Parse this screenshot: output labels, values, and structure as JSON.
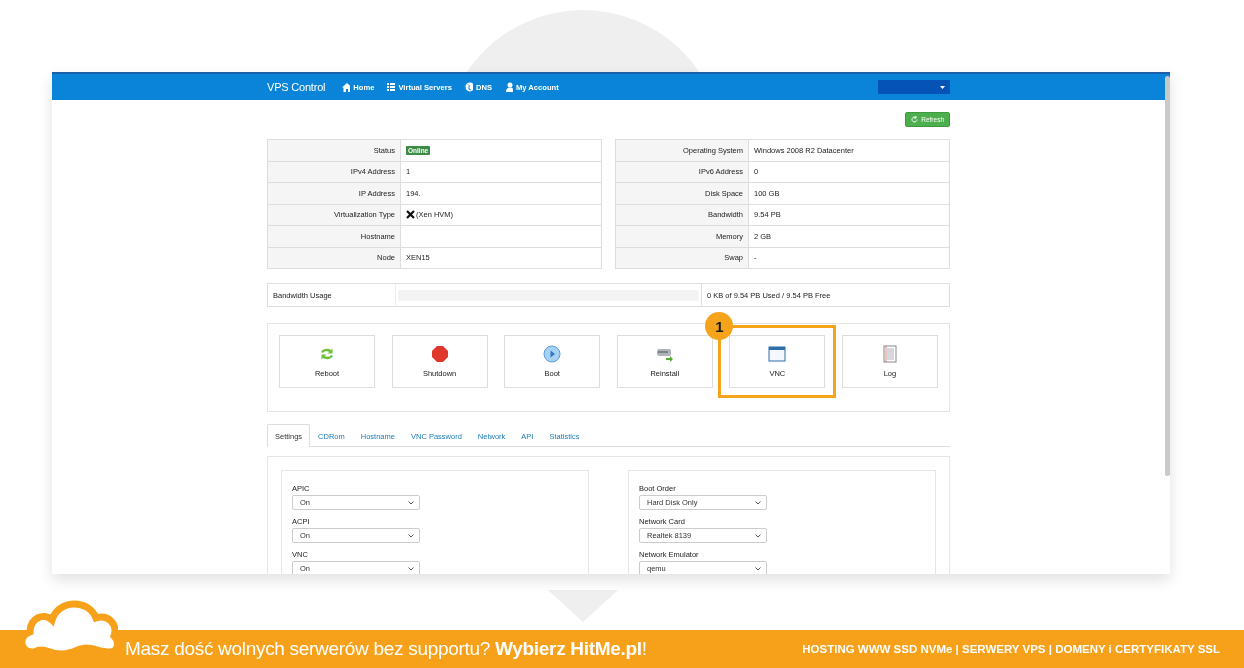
{
  "nav": {
    "brand": "VPS Control",
    "items": [
      {
        "label": "Home"
      },
      {
        "label": "Virtual Servers"
      },
      {
        "label": "DNS"
      },
      {
        "label": "My Account"
      }
    ]
  },
  "refresh_button": "Refresh",
  "info_left": [
    {
      "label": "Status",
      "value": "Online",
      "kind": "badge"
    },
    {
      "label": "IPv4 Address",
      "value": "1",
      "kind": "text"
    },
    {
      "label": "IP Address",
      "value": "194.",
      "kind": "text"
    },
    {
      "label": "Virtualization Type",
      "value": "(Xen HVM)",
      "kind": "icon-text"
    },
    {
      "label": "Hostname",
      "kind": "text"
    },
    {
      "label": "Node",
      "value": "XEN15",
      "kind": "text"
    }
  ],
  "info_right": [
    {
      "label": "Operating System",
      "value": "Windows 2008 R2 Datacenter",
      "kind": "text"
    },
    {
      "label": "IPv6 Address",
      "value": "0",
      "kind": "text"
    },
    {
      "label": "Disk Space",
      "value": "100 GB",
      "kind": "text"
    },
    {
      "label": "Bandwidth",
      "value": "9.54 PB",
      "kind": "text"
    },
    {
      "label": "Memory",
      "value": "2 GB",
      "kind": "text"
    },
    {
      "label": "Swap",
      "value": "-",
      "kind": "text"
    }
  ],
  "bandwidth_usage": {
    "label": "Bandwidth Usage",
    "level": 0,
    "reading": "0 KB of 9.54 PB Used / 9.54 PB Free"
  },
  "actions": [
    {
      "label": "Reboot",
      "highlighted": false
    },
    {
      "label": "Shutdown",
      "highlighted": false
    },
    {
      "label": "Boot",
      "highlighted": false
    },
    {
      "label": "Reinstall",
      "highlighted": false
    },
    {
      "label": "VNC",
      "highlighted": true
    },
    {
      "label": "Log",
      "highlighted": false
    }
  ],
  "annotation_label": "1",
  "tabs": [
    {
      "label": "Settings",
      "selected": true
    },
    {
      "label": "CDRom",
      "selected": false
    },
    {
      "label": "Hostname",
      "selected": false
    },
    {
      "label": "VNC Password",
      "selected": false
    },
    {
      "label": "Network",
      "selected": false
    },
    {
      "label": "API",
      "selected": false
    },
    {
      "label": "Statistics",
      "selected": false
    }
  ],
  "settings_left": [
    {
      "label": "APIC",
      "value": "On"
    },
    {
      "label": "ACPI",
      "value": "On"
    },
    {
      "label": "VNC",
      "value": "On"
    }
  ],
  "settings_right": [
    {
      "label": "Boot Order",
      "value": "Hard Disk Only"
    },
    {
      "label": "Network Card",
      "value": "Realtek 8139"
    },
    {
      "label": "Network Emulator",
      "value": "qemu"
    }
  ],
  "banner": {
    "slogan": "Masz dość wolnych serwerów bez supportu? **Wybierz HitMe.pl**!",
    "services": "HOSTING WWW SSD NVMe | SERWERY VPS | DOMENY i CERTYFIKATY SSL"
  }
}
